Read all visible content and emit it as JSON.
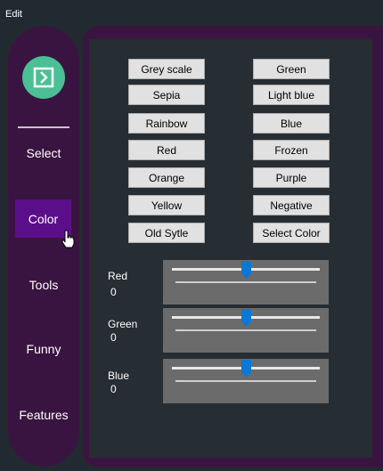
{
  "menubar": {
    "edit_label": "Edit"
  },
  "sidebar": {
    "logo_icon": "collapse-arrow-icon",
    "items": [
      {
        "label": "Select",
        "active": false
      },
      {
        "label": "Color",
        "active": true
      },
      {
        "label": "Tools",
        "active": false
      },
      {
        "label": "Funny",
        "active": false
      },
      {
        "label": "Features",
        "active": false
      }
    ]
  },
  "filters": {
    "left": [
      "Grey scale",
      "Sepia",
      "Rainbow",
      "Red",
      "Orange",
      "Yellow",
      "Old Sytle"
    ],
    "right": [
      "Green",
      "Light blue",
      "Blue",
      "Frozen",
      "Purple",
      "Negative",
      "Select Color"
    ]
  },
  "sliders": [
    {
      "label": "Red",
      "value": "0",
      "level": 0.5
    },
    {
      "label": "Green",
      "value": "0",
      "level": 0.5
    },
    {
      "label": "Blue",
      "value": "0",
      "level": 0.5
    }
  ],
  "colors": {
    "background": "#222a31",
    "panel": "#3a1440",
    "active_nav": "#5b0e8a",
    "logo": "#4bbf96",
    "slider_thumb": "#0a78d7"
  }
}
